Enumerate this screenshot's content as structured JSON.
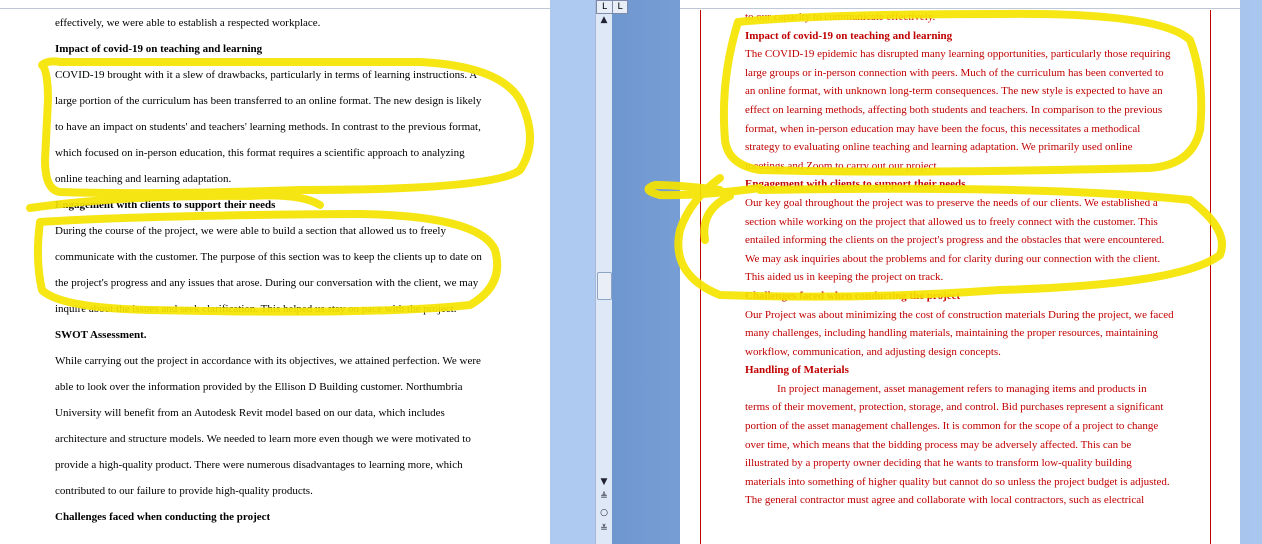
{
  "left": {
    "lines": [
      {
        "t": "effectively, we were able to establish a respected workplace.",
        "b": false
      },
      {
        "t": "Impact of covid-19 on teaching and learning",
        "b": true
      },
      {
        "t": "COVID-19 brought with it a slew of drawbacks, particularly in terms of learning instructions. A",
        "b": false
      },
      {
        "t": "large portion of the curriculum has been transferred to an online format. The new design is likely",
        "b": false
      },
      {
        "t": "to have an impact on students' and teachers' learning methods. In contrast to the previous format,",
        "b": false
      },
      {
        "t": "which focused on in-person education, this format requires a scientific approach to analyzing",
        "b": false
      },
      {
        "t": "online teaching and learning adaptation.",
        "b": false
      },
      {
        "t": "Engagement with clients to support their needs",
        "b": true
      },
      {
        "t": "During the course of the project, we were able to build a section that allowed us to freely",
        "b": false
      },
      {
        "t": "communicate with the customer. The purpose of this section was to keep the clients up to date on",
        "b": false
      },
      {
        "t": "the project's progress and any issues that arose. During our conversation with the client, we may",
        "b": false
      },
      {
        "t": "inquire about the issues and seek clarification. This helped us stay on pace with the project.",
        "b": false
      },
      {
        "t": "SWOT Assessment.",
        "b": true
      },
      {
        "t": "While carrying out the project in accordance with its objectives, we attained perfection. We were",
        "b": false
      },
      {
        "t": "able to look over the information provided by the Ellison D Building customer. Northumbria",
        "b": false
      },
      {
        "t": "University will benefit from an Autodesk Revit model based on our data, which includes",
        "b": false
      },
      {
        "t": "architecture and structure models. We needed to learn more even though we were motivated to",
        "b": false
      },
      {
        "t": "provide a high-quality product. There were numerous disadvantages to learning more, which",
        "b": false
      },
      {
        "t": "contributed to our failure to provide high-quality products.",
        "b": false
      },
      {
        "t": "Challenges faced when conducting the project",
        "b": true
      }
    ]
  },
  "right": {
    "lines": [
      {
        "t": "to our capacity to communicate effectively.",
        "b": false
      },
      {
        "t": "Impact of covid-19 on teaching and learning",
        "b": true
      },
      {
        "t": "The COVID-19 epidemic has disrupted many learning opportunities, particularly those requiring",
        "b": false
      },
      {
        "t": "large groups or in-person connection with peers. Much of the curriculum has been converted to",
        "b": false
      },
      {
        "t": "an online format, with unknown long-term consequences. The new style is expected to have an",
        "b": false
      },
      {
        "t": "effect on learning methods, affecting both students and teachers. In comparison to the previous",
        "b": false
      },
      {
        "t": "format, when in-person education may have been the focus, this necessitates a methodical",
        "b": false
      },
      {
        "t": "strategy to evaluating online teaching and learning adaptation. We primarily used online",
        "b": false
      },
      {
        "t": "meetings and Zoom to carry out our project.",
        "b": false
      },
      {
        "t": "Engagement with clients to support their needs",
        "b": true
      },
      {
        "t": "Our key goal throughout the project was to preserve the needs of our clients. We established a",
        "b": false
      },
      {
        "t": "section while working on the project that allowed us to freely connect with the customer. This",
        "b": false
      },
      {
        "t": "entailed informing the clients on the project's progress and the obstacles that were encountered.",
        "b": false
      },
      {
        "t": "We may ask inquiries about the problems and for clarity during our connection with the client.",
        "b": false
      },
      {
        "t": "This aided us in keeping the project on track.",
        "b": false
      },
      {
        "t": "Challenges faced when conducting the project",
        "b": true
      },
      {
        "t": "Our Project was about minimizing the cost of construction materials During the project, we faced",
        "b": false
      },
      {
        "t": "many challenges, including handling materials, maintaining the proper resources, maintaining",
        "b": false
      },
      {
        "t": "workflow, communication, and adjusting design concepts.",
        "b": false
      },
      {
        "t": "Handling of Materials",
        "b": true
      },
      {
        "t": "        In project management, asset management refers to managing items and products in",
        "b": false
      },
      {
        "t": "terms of their movement, protection, storage, and control. Bid purchases represent a significant",
        "b": false
      },
      {
        "t": "portion of the asset management challenges. It is common for the scope of a project to change",
        "b": false
      },
      {
        "t": "over time, which means that the bidding process may be adversely affected. This can be",
        "b": false
      },
      {
        "t": "illustrated by a property owner deciding that he wants to transform low-quality building",
        "b": false
      },
      {
        "t": "materials into something of higher quality but cannot do so unless the project budget is adjusted.",
        "b": false
      },
      {
        "t": "The general contractor must agree and collaborate with local contractors, such as electrical",
        "b": false
      }
    ]
  },
  "colors": {
    "highlight": "#f5e400",
    "red_text": "#c00000"
  },
  "icons": {
    "scroll_up": "▲",
    "scroll_down": "▼",
    "prev_page": "≜",
    "select_browse": "○",
    "next_page": "≚",
    "ruler_toggle": "L"
  }
}
